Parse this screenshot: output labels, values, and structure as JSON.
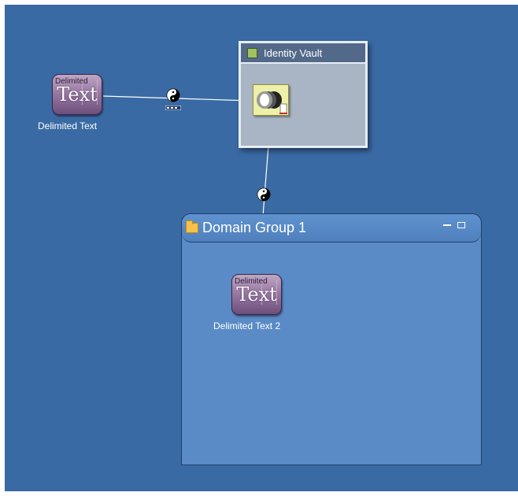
{
  "canvas": {
    "background": "#3a6aa4"
  },
  "nodes": {
    "delimited_text": {
      "small_text": "Delimited",
      "big_text": "Text",
      "label": "Delimited Text"
    },
    "delimited_text_2": {
      "small_text": "Delimited",
      "big_text": "Text",
      "label": "Delimited Text 2"
    }
  },
  "identity_vault": {
    "title": "Identity Vault"
  },
  "domain_group": {
    "title": "Domain Group 1"
  },
  "icons": {
    "driver_connector": "yin-yang-icon",
    "vault_node": "identity-vault-node-icon",
    "group_folder": "folder-icon",
    "group_minimize": "minimize-icon",
    "group_maximize": "maximize-icon"
  }
}
